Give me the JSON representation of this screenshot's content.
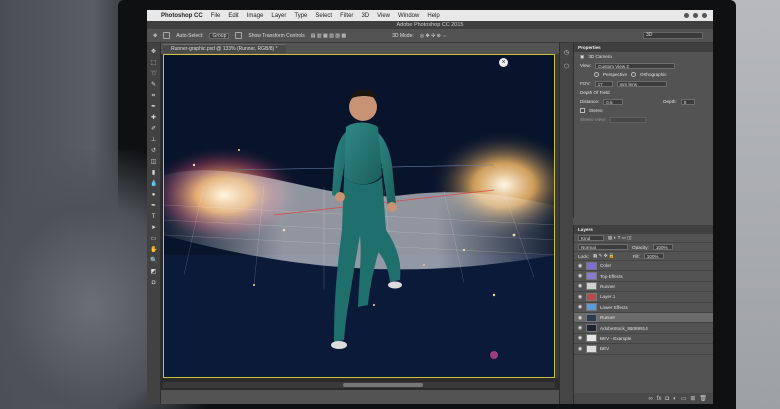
{
  "menubar": {
    "app_name": "Photoshop CC",
    "items": [
      "File",
      "Edit",
      "Image",
      "Layer",
      "Type",
      "Select",
      "Filter",
      "3D",
      "View",
      "Window",
      "Help"
    ]
  },
  "window_title": "Adobe Photoshop CC 2015",
  "options_bar": {
    "auto_select_label": "Auto-Select:",
    "auto_select_value": "Group",
    "transform_label": "Show Transform Controls",
    "mode_label": "3D Mode:",
    "right_field": "3D"
  },
  "document_tab": "Runner-graphic.psd @ 133% (Runner, RGB/8) *",
  "properties": {
    "panel_title": "Properties",
    "section": "3D Camera",
    "view_label": "View:",
    "view_value": "Custom View 2",
    "perspective": "Perspective",
    "orthographic": "Orthographic",
    "fov_label": "FOV:",
    "fov_value": "17",
    "fov_unit": "mm lens",
    "dof_label": "Depth Of Field",
    "distance_label": "Distance:",
    "distance_value": "0.5",
    "depth_label": "Depth:",
    "depth_value": "0",
    "stereo_label": "Stereo",
    "stereo_sub": "Stereo View:"
  },
  "layers": {
    "panel_title": "Layers",
    "kind_value": "Kind",
    "blend_mode": "Normal",
    "opacity_label": "Opacity:",
    "opacity_value": "100%",
    "lock_label": "Lock:",
    "fill_label": "Fill:",
    "fill_value": "100%",
    "rows": [
      {
        "name": "Color",
        "color": "#7b6fd6"
      },
      {
        "name": "Top Effects",
        "color": "#8a7ad8"
      },
      {
        "name": "Runner",
        "color": "#cfcfcf"
      },
      {
        "name": "Layer 1",
        "color": "#b94a4a"
      },
      {
        "name": "Lower Effects",
        "color": "#5b9ad6"
      },
      {
        "name": "Runner",
        "color": "#2b3a55"
      },
      {
        "name": "AdobeStock_95069914",
        "color": "#1d2436"
      },
      {
        "name": "BEV - Example",
        "color": "#e5e5e5"
      },
      {
        "name": "BEV",
        "color": "#dddddd"
      }
    ],
    "selected_index": 5
  }
}
